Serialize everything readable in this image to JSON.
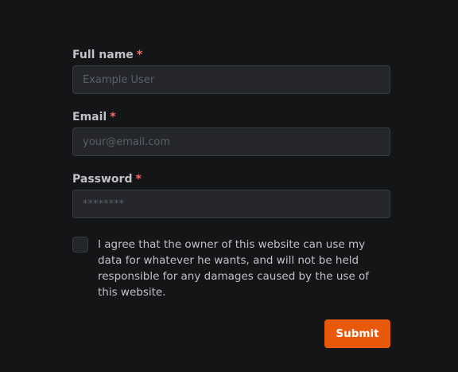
{
  "form": {
    "full_name": {
      "label": "Full name",
      "required_mark": "*",
      "placeholder": "Example User",
      "value": ""
    },
    "email": {
      "label": "Email",
      "required_mark": "*",
      "placeholder": "your@email.com",
      "value": ""
    },
    "password": {
      "label": "Password",
      "required_mark": "*",
      "placeholder": "********",
      "value": ""
    },
    "agreement": {
      "checked": false,
      "text": "I agree that the owner of this website can use my data for whatever he wants, and will not be held responsible for any damages caused by the use of this website."
    },
    "submit_label": "Submit"
  },
  "colors": {
    "background": "#141517",
    "input_background": "#25262b",
    "input_border": "#373a40",
    "label_text": "#c1c2c5",
    "placeholder_text": "#5c5f66",
    "required_mark": "#ff6b6b",
    "accent": "#e8590c"
  }
}
